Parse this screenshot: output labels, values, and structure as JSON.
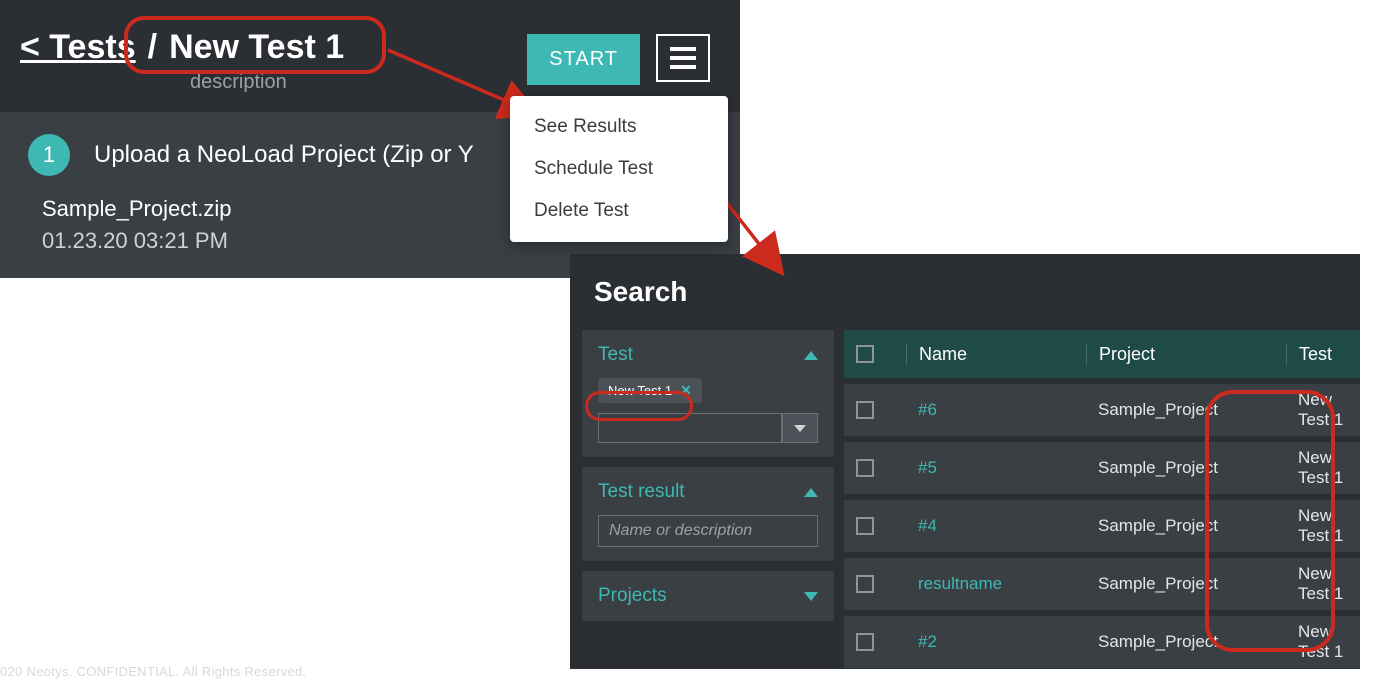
{
  "panel1": {
    "back_label": "< Tests",
    "slash": "/",
    "test_name": "New Test 1",
    "description_label": "description",
    "start_label": "START",
    "dropdown": {
      "see_results": "See Results",
      "schedule_test": "Schedule Test",
      "delete_test": "Delete Test"
    },
    "step": {
      "num": "1",
      "label": "Upload a NeoLoad Project (Zip or Y"
    },
    "file_name": "Sample_Project.zip",
    "file_date": "01.23.20 03:21 PM"
  },
  "panel2": {
    "title": "Search",
    "filters": {
      "test_label": "Test",
      "chip_label": "New Test 1",
      "result_label": "Test result",
      "result_placeholder": "Name or description",
      "projects_label": "Projects"
    },
    "columns": {
      "name": "Name",
      "project": "Project",
      "test": "Test"
    },
    "rows": [
      {
        "name": "#6",
        "project": "Sample_Project",
        "test": "New Test 1"
      },
      {
        "name": "#5",
        "project": "Sample_Project",
        "test": "New Test 1"
      },
      {
        "name": "#4",
        "project": "Sample_Project",
        "test": "New Test 1"
      },
      {
        "name": "resultname",
        "project": "Sample_Project",
        "test": "New Test 1"
      },
      {
        "name": "#2",
        "project": "Sample_Project",
        "test": "New Test 1"
      }
    ]
  },
  "footer": "020 Neotys. CONFIDENTIAL. All Rights Reserved."
}
